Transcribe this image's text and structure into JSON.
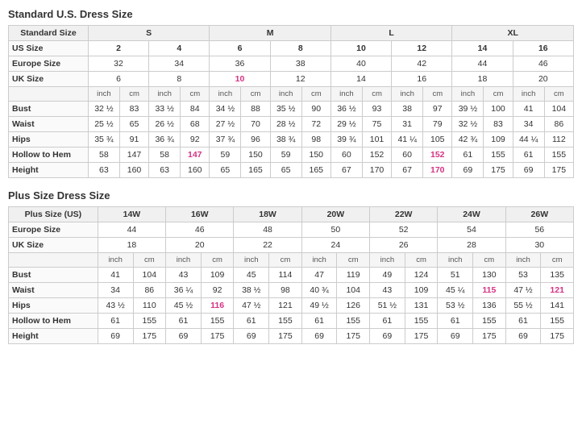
{
  "standard": {
    "title": "Standard U.S. Dress Size",
    "size_groups": [
      "S",
      "M",
      "L",
      "XL"
    ],
    "headers": {
      "standard_size": "Standard Size",
      "us_size": "US Size",
      "europe_size": "Europe Size",
      "uk_size": "UK Size",
      "inch": "inch",
      "cm": "cm"
    },
    "us_sizes": [
      "2",
      "4",
      "6",
      "8",
      "10",
      "12",
      "14",
      "16"
    ],
    "europe_sizes": [
      "32",
      "34",
      "36",
      "38",
      "40",
      "42",
      "44",
      "46"
    ],
    "uk_sizes": [
      "6",
      "8",
      "10",
      "12",
      "14",
      "16",
      "18",
      "20"
    ],
    "measurements": {
      "bust": [
        "32 ½",
        "83",
        "33 ½",
        "84",
        "34 ½",
        "88",
        "35 ½",
        "90",
        "36 ½",
        "93",
        "38",
        "97",
        "39 ½",
        "100",
        "41",
        "104"
      ],
      "waist": [
        "25 ½",
        "65",
        "26 ½",
        "68",
        "27 ½",
        "70",
        "28 ½",
        "72",
        "29 ½",
        "75",
        "31",
        "79",
        "32 ½",
        "83",
        "34",
        "86"
      ],
      "hips": [
        "35 ¾",
        "91",
        "36 ¾",
        "92",
        "37 ¾",
        "96",
        "38 ¾",
        "98",
        "39 ¾",
        "101",
        "41 ¼",
        "105",
        "42 ¾",
        "109",
        "44 ¼",
        "112"
      ],
      "hollow_to_hem": [
        "58",
        "147",
        "58",
        "147",
        "59",
        "150",
        "59",
        "150",
        "60",
        "152",
        "60",
        "152",
        "61",
        "155",
        "61",
        "155"
      ],
      "height": [
        "63",
        "160",
        "63",
        "160",
        "65",
        "165",
        "65",
        "165",
        "67",
        "170",
        "67",
        "170",
        "69",
        "175",
        "69",
        "175"
      ]
    },
    "pink_cells": {
      "uk": [
        2
      ],
      "hollow_to_hem": [
        3,
        11
      ],
      "height": [
        11
      ],
      "waist": [
        14
      ],
      "hips": [
        14
      ]
    }
  },
  "plus": {
    "title": "Plus Size Dress Size",
    "headers": {
      "plus_size_us": "Plus Size (US)",
      "europe_size": "Europe Size",
      "uk_size": "UK Size",
      "inch": "inch",
      "cm": "cm"
    },
    "us_sizes": [
      "14W",
      "16W",
      "18W",
      "20W",
      "22W",
      "24W",
      "26W"
    ],
    "europe_sizes": [
      "44",
      "46",
      "48",
      "50",
      "52",
      "54",
      "56"
    ],
    "uk_sizes": [
      "18",
      "20",
      "22",
      "24",
      "26",
      "28",
      "30"
    ],
    "measurements": {
      "bust": [
        "41",
        "104",
        "43",
        "109",
        "45",
        "114",
        "47",
        "119",
        "49",
        "124",
        "51",
        "130",
        "53",
        "135"
      ],
      "waist": [
        "34",
        "86",
        "36 ¼",
        "92",
        "38 ½",
        "98",
        "40 ¾",
        "104",
        "43",
        "109",
        "45 ¼",
        "115",
        "47 ½",
        "121"
      ],
      "hips": [
        "43 ½",
        "110",
        "45 ½",
        "116",
        "47 ½",
        "121",
        "49 ½",
        "126",
        "51 ½",
        "131",
        "53 ½",
        "136",
        "55 ½",
        "141"
      ],
      "hollow_to_hem": [
        "61",
        "155",
        "61",
        "155",
        "61",
        "155",
        "61",
        "155",
        "61",
        "155",
        "61",
        "155",
        "61",
        "155"
      ],
      "height": [
        "69",
        "175",
        "69",
        "175",
        "69",
        "175",
        "69",
        "175",
        "69",
        "175",
        "69",
        "175",
        "69",
        "175"
      ]
    }
  }
}
